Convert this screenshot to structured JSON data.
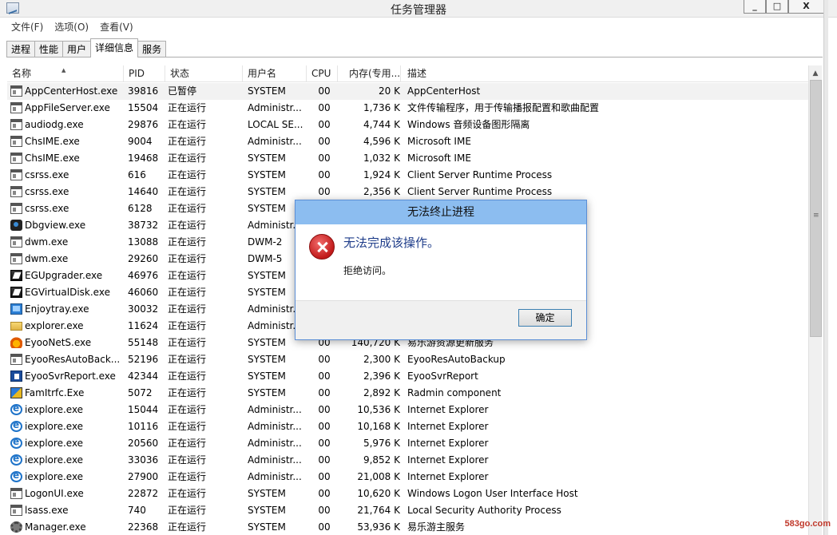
{
  "window": {
    "title": "任务管理器",
    "controls": [
      "_",
      "□",
      "X"
    ]
  },
  "menu": [
    "文件(F)",
    "选项(O)",
    "查看(V)"
  ],
  "tabs": [
    {
      "label": "进程",
      "active": false
    },
    {
      "label": "性能",
      "active": false
    },
    {
      "label": "用户",
      "active": false
    },
    {
      "label": "详细信息",
      "active": true
    },
    {
      "label": "服务",
      "active": false
    }
  ],
  "columns": [
    "名称",
    "PID",
    "状态",
    "用户名",
    "CPU",
    "内存(专用...",
    "描述"
  ],
  "rows": [
    {
      "icon": "window",
      "name": "AppCenterHost.exe",
      "pid": "39816",
      "state": "已暂停",
      "user": "SYSTEM",
      "cpu": "00",
      "mem": "20 K",
      "desc": "AppCenterHost"
    },
    {
      "icon": "window",
      "name": "AppFileServer.exe",
      "pid": "15504",
      "state": "正在运行",
      "user": "Administr...",
      "cpu": "00",
      "mem": "1,736 K",
      "desc": "文件传输程序，用于传输播报配置和歌曲配置"
    },
    {
      "icon": "window",
      "name": "audiodg.exe",
      "pid": "29876",
      "state": "正在运行",
      "user": "LOCAL SE...",
      "cpu": "00",
      "mem": "4,744 K",
      "desc": "Windows 音频设备图形隔离"
    },
    {
      "icon": "window",
      "name": "ChsIME.exe",
      "pid": "9004",
      "state": "正在运行",
      "user": "Administr...",
      "cpu": "00",
      "mem": "4,596 K",
      "desc": "Microsoft IME"
    },
    {
      "icon": "window",
      "name": "ChsIME.exe",
      "pid": "19468",
      "state": "正在运行",
      "user": "SYSTEM",
      "cpu": "00",
      "mem": "1,032 K",
      "desc": "Microsoft IME"
    },
    {
      "icon": "window",
      "name": "csrss.exe",
      "pid": "616",
      "state": "正在运行",
      "user": "SYSTEM",
      "cpu": "00",
      "mem": "1,924 K",
      "desc": "Client Server Runtime Process"
    },
    {
      "icon": "window",
      "name": "csrss.exe",
      "pid": "14640",
      "state": "正在运行",
      "user": "SYSTEM",
      "cpu": "00",
      "mem": "2,356 K",
      "desc": "Client Server Runtime Process"
    },
    {
      "icon": "window",
      "name": "csrss.exe",
      "pid": "6128",
      "state": "正在运行",
      "user": "SYSTEM",
      "cpu": "",
      "mem": "",
      "desc": ""
    },
    {
      "icon": "bug",
      "name": "Dbgview.exe",
      "pid": "38732",
      "state": "正在运行",
      "user": "Administr...",
      "cpu": "",
      "mem": "",
      "desc": ""
    },
    {
      "icon": "window",
      "name": "dwm.exe",
      "pid": "13088",
      "state": "正在运行",
      "user": "DWM-2",
      "cpu": "",
      "mem": "",
      "desc": ""
    },
    {
      "icon": "window",
      "name": "dwm.exe",
      "pid": "29260",
      "state": "正在运行",
      "user": "DWM-5",
      "cpu": "",
      "mem": "",
      "desc": ""
    },
    {
      "icon": "disk",
      "name": "EGUpgrader.exe",
      "pid": "46976",
      "state": "正在运行",
      "user": "SYSTEM",
      "cpu": "",
      "mem": "",
      "desc": ""
    },
    {
      "icon": "disk",
      "name": "EGVirtualDisk.exe",
      "pid": "46060",
      "state": "正在运行",
      "user": "SYSTEM",
      "cpu": "",
      "mem": "",
      "desc": ""
    },
    {
      "icon": "monitor",
      "name": "Enjoytray.exe",
      "pid": "30032",
      "state": "正在运行",
      "user": "Administr...",
      "cpu": "",
      "mem": "",
      "desc": ""
    },
    {
      "icon": "folder",
      "name": "explorer.exe",
      "pid": "11624",
      "state": "正在运行",
      "user": "Administr...",
      "cpu": "",
      "mem": "",
      "desc": ""
    },
    {
      "icon": "flame",
      "name": "EyooNetS.exe",
      "pid": "55148",
      "state": "正在运行",
      "user": "SYSTEM",
      "cpu": "00",
      "mem": "140,720 K",
      "desc": "易乐游资源更新服务"
    },
    {
      "icon": "window",
      "name": "EyooResAutoBack...",
      "pid": "52196",
      "state": "正在运行",
      "user": "SYSTEM",
      "cpu": "00",
      "mem": "2,300 K",
      "desc": "EyooResAutoBackup"
    },
    {
      "icon": "blue",
      "name": "EyooSvrReport.exe",
      "pid": "42344",
      "state": "正在运行",
      "user": "SYSTEM",
      "cpu": "00",
      "mem": "2,396 K",
      "desc": "EyooSvrReport"
    },
    {
      "icon": "color",
      "name": "FamItrfc.Exe",
      "pid": "5072",
      "state": "正在运行",
      "user": "SYSTEM",
      "cpu": "00",
      "mem": "2,892 K",
      "desc": "Radmin component"
    },
    {
      "icon": "ie",
      "name": "iexplore.exe",
      "pid": "15044",
      "state": "正在运行",
      "user": "Administr...",
      "cpu": "00",
      "mem": "10,536 K",
      "desc": "Internet Explorer"
    },
    {
      "icon": "ie",
      "name": "iexplore.exe",
      "pid": "10116",
      "state": "正在运行",
      "user": "Administr...",
      "cpu": "00",
      "mem": "10,168 K",
      "desc": "Internet Explorer"
    },
    {
      "icon": "ie",
      "name": "iexplore.exe",
      "pid": "20560",
      "state": "正在运行",
      "user": "Administr...",
      "cpu": "00",
      "mem": "5,976 K",
      "desc": "Internet Explorer"
    },
    {
      "icon": "ie",
      "name": "iexplore.exe",
      "pid": "33036",
      "state": "正在运行",
      "user": "Administr...",
      "cpu": "00",
      "mem": "9,852 K",
      "desc": "Internet Explorer"
    },
    {
      "icon": "ie",
      "name": "iexplore.exe",
      "pid": "27900",
      "state": "正在运行",
      "user": "Administr...",
      "cpu": "00",
      "mem": "21,008 K",
      "desc": "Internet Explorer"
    },
    {
      "icon": "window",
      "name": "LogonUI.exe",
      "pid": "22872",
      "state": "正在运行",
      "user": "SYSTEM",
      "cpu": "00",
      "mem": "10,620 K",
      "desc": "Windows Logon User Interface Host"
    },
    {
      "icon": "window",
      "name": "lsass.exe",
      "pid": "740",
      "state": "正在运行",
      "user": "SYSTEM",
      "cpu": "00",
      "mem": "21,764 K",
      "desc": "Local Security Authority Process"
    },
    {
      "icon": "gear",
      "name": "Manager.exe",
      "pid": "22368",
      "state": "正在运行",
      "user": "SYSTEM",
      "cpu": "00",
      "mem": "53,936 K",
      "desc": "易乐游主服务"
    }
  ],
  "scrollbar": {
    "up": "▲",
    "grip": "≡"
  },
  "dialog": {
    "title": "无法终止进程",
    "message": "无法完成该操作。",
    "detail": "拒绝访问。",
    "ok_label": "确定"
  },
  "watermark": "583go.com"
}
